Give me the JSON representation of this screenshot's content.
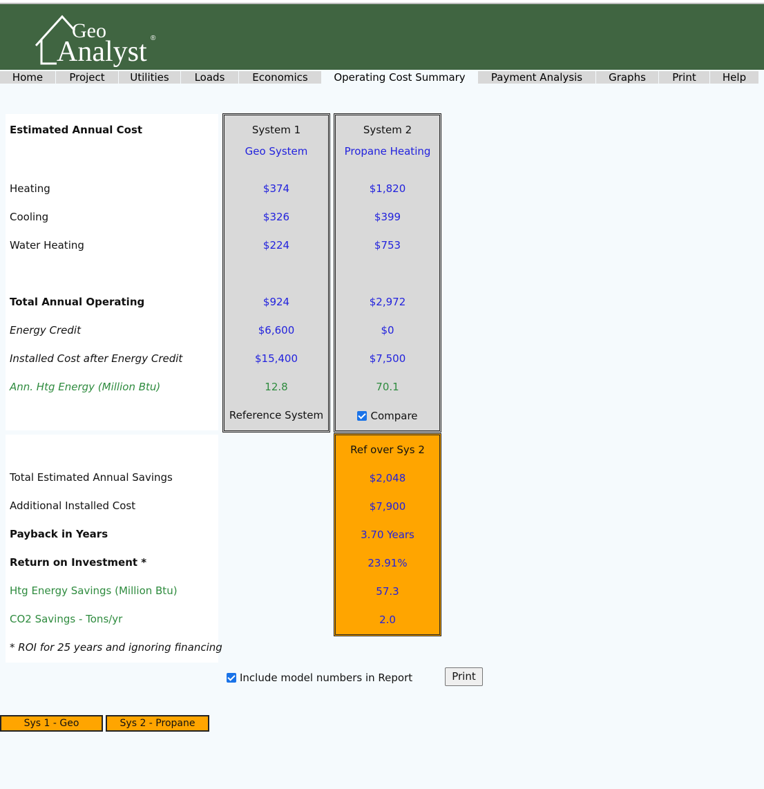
{
  "app": {
    "logo_top": "Geo",
    "logo_bottom": "Analyst",
    "registered_mark": "®"
  },
  "nav": {
    "home": "Home",
    "project": "Project",
    "utilities": "Utilities",
    "loads": "Loads",
    "economics": "Economics",
    "operating_cost_summary": "Operating Cost Summary",
    "payment_analysis": "Payment Analysis",
    "graphs": "Graphs",
    "print": "Print",
    "help": "Help",
    "active": "Operating Cost Summary"
  },
  "labels": {
    "estimated_annual_cost": "Estimated Annual Cost",
    "heating": "Heating",
    "cooling": "Cooling",
    "water_heating": "Water Heating",
    "total_annual_operating": "Total Annual Operating",
    "energy_credit": "Energy Credit",
    "installed_cost_after_credit": "Installed Cost after Energy Credit",
    "ann_htg_energy": "Ann. Htg Energy (Million Btu)"
  },
  "system1": {
    "header": "System 1",
    "name": "Geo System",
    "heating": "$374",
    "cooling": "$326",
    "water_heating": "$224",
    "total_annual_operating": "$924",
    "energy_credit": "$6,600",
    "installed_cost_after_credit": "$15,400",
    "ann_htg_energy": "12.8",
    "footer": "Reference System"
  },
  "system2": {
    "header": "System 2",
    "name": "Propane Heating",
    "heating": "$1,820",
    "cooling": "$399",
    "water_heating": "$753",
    "total_annual_operating": "$2,972",
    "energy_credit": "$0",
    "installed_cost_after_credit": "$7,500",
    "ann_htg_energy": "70.1",
    "compare_label": "Compare",
    "compare_checked": true
  },
  "savings_labels": {
    "total_annual_savings": "Total Estimated Annual Savings",
    "additional_installed_cost": "Additional Installed Cost",
    "payback": "Payback in Years",
    "roi": "Return on Investment *",
    "htg_energy_savings": "Htg Energy Savings (Million Btu)",
    "co2_savings": "CO2 Savings - Tons/yr",
    "footnote": "* ROI for 25 years and ignoring financing"
  },
  "savings": {
    "header": "Ref over Sys 2",
    "total_annual_savings": "$2,048",
    "additional_installed_cost": "$7,900",
    "payback": "3.70 Years",
    "roi": "23.91%",
    "htg_energy_savings": "57.3",
    "co2_savings": "2.0"
  },
  "report": {
    "include_model_numbers_label": "Include model numbers in Report",
    "include_model_numbers_checked": true,
    "print_button": "Print"
  },
  "system_buttons": {
    "sys1": "Sys 1 - Geo",
    "sys2": "Sys 2 - Propane"
  },
  "colors": {
    "header_green": "#406541",
    "value_blue": "#2222dd",
    "energy_green": "#2e8b3e",
    "savings_orange": "#ffa500",
    "system_gray": "#d9d9d9"
  }
}
